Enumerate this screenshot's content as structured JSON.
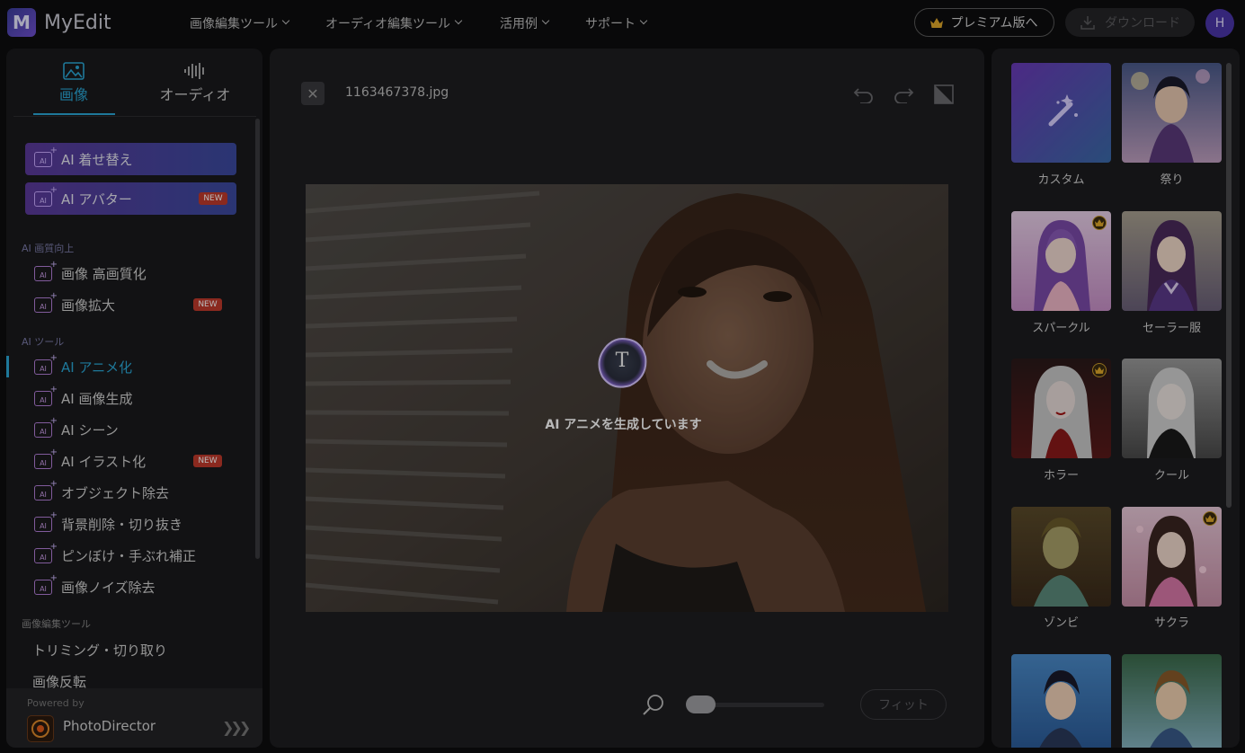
{
  "app": {
    "name": "MyEdit",
    "logo_letter": "M"
  },
  "header": {
    "nav": [
      {
        "label": "画像編集ツール"
      },
      {
        "label": "オーディオ編集ツール"
      },
      {
        "label": "活用例"
      },
      {
        "label": "サポート"
      }
    ],
    "premium_label": "プレミアム版へ",
    "download_label": "ダウンロード",
    "avatar_initial": "H"
  },
  "sidebar": {
    "tabs": [
      {
        "label": "画像"
      },
      {
        "label": "オーディオ"
      }
    ],
    "feature_buttons": [
      {
        "label": "AI 着せ替え",
        "new": false
      },
      {
        "label": "AI アバター",
        "new": true
      }
    ],
    "sections": [
      {
        "title": "AI 画質向上",
        "items": [
          {
            "label": "画像 高画質化",
            "new": false
          },
          {
            "label": "画像拡大",
            "new": true
          }
        ]
      },
      {
        "title": "AI ツール",
        "items": [
          {
            "label": "AI アニメ化",
            "new": false,
            "active": true
          },
          {
            "label": "AI 画像生成",
            "new": false
          },
          {
            "label": "AI シーン",
            "new": false
          },
          {
            "label": "AI イラスト化",
            "new": true
          },
          {
            "label": "オブジェクト除去",
            "new": false
          },
          {
            "label": "背景削除・切り抜き",
            "new": false
          },
          {
            "label": "ピンぼけ・手ぶれ補正",
            "new": false
          },
          {
            "label": "画像ノイズ除去",
            "new": false
          }
        ]
      },
      {
        "title": "画像編集ツール",
        "items": [
          {
            "label": "トリミング・切り取り"
          },
          {
            "label": "画像反転"
          }
        ]
      }
    ],
    "new_badge": "NEW",
    "icon_text": "AI",
    "powered_by": "Powered by",
    "product": "PhotoDirector"
  },
  "editor": {
    "filename": "1163467378.jpg",
    "status_text": "AI アニメを生成しています",
    "bubble_letter": "T",
    "fit_label": "フィット",
    "zoom_level": 0.0
  },
  "styles": {
    "title": "",
    "items": [
      {
        "label": "カスタム",
        "premium": false
      },
      {
        "label": "祭り",
        "premium": false
      },
      {
        "label": "スパークル",
        "premium": true
      },
      {
        "label": "セーラー服",
        "premium": false
      },
      {
        "label": "ホラー",
        "premium": true
      },
      {
        "label": "クール",
        "premium": false
      },
      {
        "label": "ゾンビ",
        "premium": false
      },
      {
        "label": "サクラ",
        "premium": true
      },
      {
        "label": "",
        "premium": false
      },
      {
        "label": "",
        "premium": false
      }
    ]
  },
  "colors": {
    "accent": "#2aa7d6",
    "brand_purple": "#5b3a9a",
    "new_badge": "#c0392b",
    "premium_gold": "#c89a2a"
  }
}
